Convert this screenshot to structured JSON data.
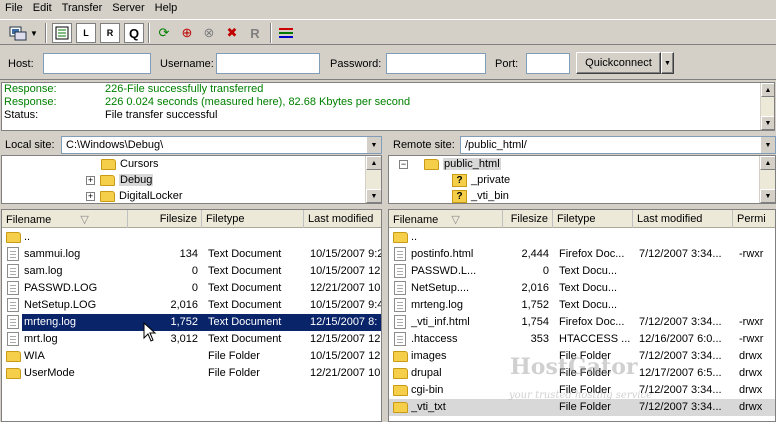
{
  "menu": [
    "File",
    "Edit",
    "Transfer",
    "Server",
    "Help"
  ],
  "toolbar": {
    "icons": [
      "site-manager-icon",
      "dropdown-arrow-icon",
      "toggle-log-icon",
      "toggle-local-tree-icon",
      "toggle-remote-tree-icon",
      "toggle-queue-icon",
      "refresh-icon",
      "process-queue-icon",
      "cancel-icon",
      "disconnect-icon",
      "reconnect-icon",
      "compare-icon"
    ]
  },
  "quickconnect": {
    "host_label": "Host:",
    "username_label": "Username:",
    "password_label": "Password:",
    "port_label": "Port:",
    "button": "Quickconnect",
    "host_value": "",
    "username_value": "",
    "password_value": "",
    "port_value": ""
  },
  "log": [
    {
      "key": "Response:",
      "value": "226-File successfully transferred",
      "color": "#008000"
    },
    {
      "key": "Response:",
      "value": "226 0.024 seconds (measured here), 82.68 Kbytes per second",
      "color": "#008000"
    },
    {
      "key": "Status:",
      "value": "File transfer successful",
      "color": "#000000"
    }
  ],
  "local": {
    "label": "Local site:",
    "path": "C:\\Windows\\Debug\\",
    "tree": [
      {
        "name": "Cursors",
        "expander": false,
        "selected": false
      },
      {
        "name": "Debug",
        "expander": true,
        "selected": true
      },
      {
        "name": "DigitalLocker",
        "expander": true,
        "selected": false
      }
    ],
    "columns": [
      "Filename",
      "Filesize",
      "Filetype",
      "Last modified"
    ],
    "files": [
      {
        "name": "..",
        "size": "",
        "type": "",
        "modified": "",
        "kind": "dir"
      },
      {
        "name": "sammui.log",
        "size": "134",
        "type": "Text Document",
        "modified": "10/15/2007 9:2",
        "kind": "file"
      },
      {
        "name": "sam.log",
        "size": "0",
        "type": "Text Document",
        "modified": "10/15/2007 12:",
        "kind": "file"
      },
      {
        "name": "PASSWD.LOG",
        "size": "0",
        "type": "Text Document",
        "modified": "12/21/2007 10:",
        "kind": "file"
      },
      {
        "name": "NetSetup.LOG",
        "size": "2,016",
        "type": "Text Document",
        "modified": "10/15/2007 9:4",
        "kind": "file"
      },
      {
        "name": "mrteng.log",
        "size": "1,752",
        "type": "Text Document",
        "modified": "12/15/2007 8:",
        "kind": "file",
        "selected": true
      },
      {
        "name": "mrt.log",
        "size": "3,012",
        "type": "Text Document",
        "modified": "12/15/2007 12:",
        "kind": "file"
      },
      {
        "name": "WIA",
        "size": "",
        "type": "File Folder",
        "modified": "10/15/2007 12:",
        "kind": "dir"
      },
      {
        "name": "UserMode",
        "size": "",
        "type": "File Folder",
        "modified": "12/21/2007 10:",
        "kind": "dir"
      }
    ]
  },
  "remote": {
    "label": "Remote site:",
    "path": "/public_html/",
    "tree": [
      {
        "name": "public_html",
        "icon": "folder",
        "selected": true
      },
      {
        "name": "_private",
        "icon": "unknown-folder",
        "selected": false
      },
      {
        "name": "_vti_bin",
        "icon": "unknown-folder",
        "selected": false
      }
    ],
    "columns": [
      "Filename",
      "Filesize",
      "Filetype",
      "Last modified",
      "Permi"
    ],
    "files": [
      {
        "name": "..",
        "size": "",
        "type": "",
        "modified": "",
        "perm": "",
        "kind": "dir"
      },
      {
        "name": "postinfo.html",
        "size": "2,444",
        "type": "Firefox Doc...",
        "modified": "7/12/2007 3:34...",
        "perm": "-rwxr",
        "kind": "file"
      },
      {
        "name": "PASSWD.L...",
        "size": "0",
        "type": "Text Docu...",
        "modified": "",
        "perm": "",
        "kind": "file"
      },
      {
        "name": "NetSetup....",
        "size": "2,016",
        "type": "Text Docu...",
        "modified": "",
        "perm": "",
        "kind": "file"
      },
      {
        "name": "mrteng.log",
        "size": "1,752",
        "type": "Text Docu...",
        "modified": "",
        "perm": "",
        "kind": "file"
      },
      {
        "name": "_vti_inf.html",
        "size": "1,754",
        "type": "Firefox Doc...",
        "modified": "7/12/2007 3:34...",
        "perm": "-rwxr",
        "kind": "file"
      },
      {
        "name": ".htaccess",
        "size": "353",
        "type": "HTACCESS ...",
        "modified": "12/16/2007 6:0...",
        "perm": "-rwxr",
        "kind": "file"
      },
      {
        "name": "images",
        "size": "",
        "type": "File Folder",
        "modified": "7/12/2007 3:34...",
        "perm": "drwx",
        "kind": "dir"
      },
      {
        "name": "drupal",
        "size": "",
        "type": "File Folder",
        "modified": "12/17/2007 6:5...",
        "perm": "drwx",
        "kind": "dir"
      },
      {
        "name": "cgi-bin",
        "size": "",
        "type": "File Folder",
        "modified": "7/12/2007 3:34...",
        "perm": "drwx",
        "kind": "dir"
      },
      {
        "name": "_vti_txt",
        "size": "",
        "type": "File Folder",
        "modified": "7/12/2007 3:34...",
        "perm": "drwx",
        "kind": "dir",
        "highlight": true
      }
    ]
  },
  "watermark": {
    "title": "HostGator",
    "subtitle": "your trusted hosting service"
  }
}
